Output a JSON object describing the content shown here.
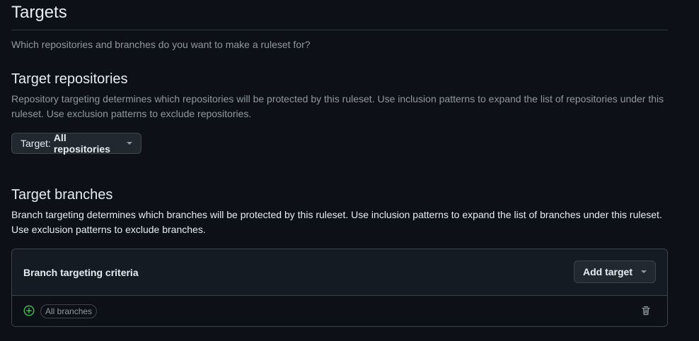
{
  "header": {
    "title": "Targets",
    "subtitle": "Which repositories and branches do you want to make a ruleset for?"
  },
  "repositories": {
    "heading": "Target repositories",
    "description": "Repository targeting determines which repositories will be protected by this ruleset. Use inclusion patterns to expand the list of repositories under this ruleset. Use exclusion patterns to exclude repositories.",
    "target_prefix": "Target:",
    "target_value": "All repositories"
  },
  "branches": {
    "heading": "Target branches",
    "description": "Branch targeting determines which branches will be protected by this ruleset. Use inclusion patterns to expand the list of branches under this ruleset. Use exclusion patterns to exclude branches.",
    "criteria_title": "Branch targeting criteria",
    "add_target_label": "Add target",
    "items": [
      {
        "label": "All branches",
        "icon": "plus-circle-icon",
        "status_color": "#3fb950"
      }
    ]
  },
  "colors": {
    "background": "#0d1117",
    "accent_green": "#3fb950",
    "muted_text": "#9198a1",
    "border": "#3d444d"
  },
  "icons": {
    "dropdown": "triangle-down-icon",
    "delete": "trash-icon"
  }
}
